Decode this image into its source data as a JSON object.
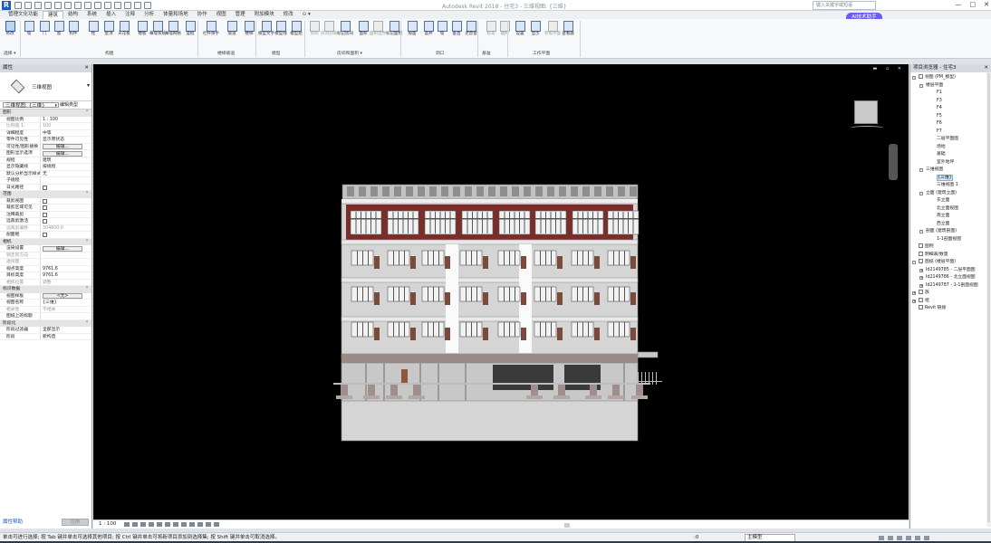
{
  "app": {
    "title": "Autodesk Revit 2018 - 住宅3 - 三维视图: {三维}",
    "search_placeholder": "键入关键字或短语",
    "ai_button": "AI技术助手",
    "window_controls": [
      "—",
      "□",
      "✕"
    ]
  },
  "tabs": [
    "管理文化功能",
    "建筑",
    "结构",
    "系统",
    "插入",
    "注释",
    "分析",
    "体量和场地",
    "协作",
    "视图",
    "管理",
    "附加模块",
    "修改",
    "⊙ ▾"
  ],
  "active_tab": "建筑",
  "ribbon": {
    "buttons": [
      {
        "label": "修改",
        "state": "selected"
      },
      {
        "label": "墙",
        "state": "normal"
      },
      {
        "label": "门",
        "state": "normal"
      },
      {
        "label": "窗",
        "state": "normal"
      },
      {
        "label": "构件",
        "state": "normal"
      },
      {
        "label": "柱",
        "state": "normal"
      },
      {
        "label": "屋顶",
        "state": "normal"
      },
      {
        "label": "天花板",
        "state": "normal"
      },
      {
        "label": "楼板",
        "state": "normal"
      },
      {
        "label": "幕墙系统",
        "state": "normal"
      },
      {
        "label": "幕墙网格",
        "state": "normal"
      },
      {
        "label": "竖梃",
        "state": "normal"
      },
      {
        "label": "栏杆扶手",
        "state": "normal"
      },
      {
        "label": "坡道",
        "state": "normal"
      },
      {
        "label": "楼梯",
        "state": "normal"
      },
      {
        "label": "模型文字",
        "state": "normal"
      },
      {
        "label": "模型线",
        "state": "normal"
      },
      {
        "label": "模型组",
        "state": "normal"
      },
      {
        "label": "房间",
        "state": "gray"
      },
      {
        "label": "房间分隔",
        "state": "gray"
      },
      {
        "label": "标记房间",
        "state": "normal"
      },
      {
        "label": "面积",
        "state": "normal"
      },
      {
        "label": "面积边界",
        "state": "gray"
      },
      {
        "label": "标记面积",
        "state": "normal"
      },
      {
        "label": "按面",
        "state": "normal"
      },
      {
        "label": "竖井",
        "state": "normal"
      },
      {
        "label": "墙",
        "state": "normal"
      },
      {
        "label": "垂直",
        "state": "normal"
      },
      {
        "label": "老虎窗",
        "state": "normal"
      },
      {
        "label": "标高",
        "state": "gray"
      },
      {
        "label": "轴网",
        "state": "gray"
      },
      {
        "label": "设置",
        "state": "normal"
      },
      {
        "label": "显示",
        "state": "normal"
      },
      {
        "label": "参照平面",
        "state": "gray"
      },
      {
        "label": "查看器",
        "state": "normal"
      }
    ],
    "groups": [
      "选择 ▾",
      "构建",
      "楼梯坡道",
      "模型",
      "房间和面积 ▾",
      "洞口",
      "基准",
      "工作平面"
    ]
  },
  "properties": {
    "header": "属性",
    "close": "✕",
    "type_name": "三维视图",
    "view_selector": "三维视图: {三维}",
    "edit_type": "编辑类型",
    "sections": [
      {
        "title": "图形",
        "rows": [
          {
            "k": "视图比例",
            "v": "1 : 100",
            "kind": "input"
          },
          {
            "k": "比例值 1:",
            "v": "100",
            "kind": "dim"
          },
          {
            "k": "详细程度",
            "v": "中等",
            "kind": "text"
          },
          {
            "k": "零件可见性",
            "v": "显示原状态",
            "kind": "text"
          },
          {
            "k": "可见性/图形替换",
            "v": "编辑...",
            "kind": "button"
          },
          {
            "k": "图形显示选项",
            "v": "编辑...",
            "kind": "button"
          },
          {
            "k": "规程",
            "v": "建筑",
            "kind": "text"
          },
          {
            "k": "显示隐藏线",
            "v": "按规程",
            "kind": "text"
          },
          {
            "k": "默认分析显示样式",
            "v": "无",
            "kind": "text"
          },
          {
            "k": "子规程",
            "v": "",
            "kind": "text"
          },
          {
            "k": "日光路径",
            "v": "",
            "kind": "check"
          }
        ]
      },
      {
        "title": "范围",
        "rows": [
          {
            "k": "裁剪视图",
            "v": "",
            "kind": "check"
          },
          {
            "k": "裁剪区域可见",
            "v": "",
            "kind": "check"
          },
          {
            "k": "注释裁剪",
            "v": "",
            "kind": "check"
          },
          {
            "k": "远裁剪激活",
            "v": "",
            "kind": "check"
          },
          {
            "k": "远裁剪偏移",
            "v": "304800.0",
            "kind": "dim"
          },
          {
            "k": "剖面框",
            "v": "",
            "kind": "check"
          }
        ]
      },
      {
        "title": "相机",
        "rows": [
          {
            "k": "渲染设置",
            "v": "编辑...",
            "kind": "button"
          },
          {
            "k": "锁定的方向",
            "v": "",
            "kind": "dim"
          },
          {
            "k": "透视图",
            "v": "",
            "kind": "dim"
          },
          {
            "k": "视点高度",
            "v": "9761.6",
            "kind": "text"
          },
          {
            "k": "目标高度",
            "v": "9761.6",
            "kind": "text"
          },
          {
            "k": "相机位置",
            "v": "调整",
            "kind": "dim"
          }
        ]
      },
      {
        "title": "标识数据",
        "rows": [
          {
            "k": "视图样板",
            "v": "<无>",
            "kind": "button"
          },
          {
            "k": "视图名称",
            "v": "{三维}",
            "kind": "text"
          },
          {
            "k": "相关性",
            "v": "不相关",
            "kind": "dim"
          },
          {
            "k": "图纸上的标题",
            "v": "",
            "kind": "text"
          }
        ]
      },
      {
        "title": "阶段化",
        "rows": [
          {
            "k": "阶段过滤器",
            "v": "全部显示",
            "kind": "text"
          },
          {
            "k": "阶段",
            "v": "新构造",
            "kind": "text"
          }
        ]
      }
    ],
    "help_link": "属性帮助",
    "apply": "应用"
  },
  "browser": {
    "header": "项目浏览器 - 住宅3",
    "close": "✕",
    "items": [
      {
        "label": "视图 (PM_模型)",
        "level": 0,
        "exp": "-",
        "icon": true
      },
      {
        "label": "楼层平面",
        "level": 1,
        "exp": "-"
      },
      {
        "label": "F1",
        "level": 2
      },
      {
        "label": "F3",
        "level": 2
      },
      {
        "label": "F4",
        "level": 2
      },
      {
        "label": "F5",
        "level": 2
      },
      {
        "label": "F6",
        "level": 2
      },
      {
        "label": "F7",
        "level": 2
      },
      {
        "label": "二层平面图",
        "level": 2
      },
      {
        "label": "场地",
        "level": 2
      },
      {
        "label": "基础",
        "level": 2
      },
      {
        "label": "室外地坪",
        "level": 2
      },
      {
        "label": "三维视图",
        "level": 1,
        "exp": "-"
      },
      {
        "label": "{三维}",
        "level": 2,
        "highlight": true
      },
      {
        "label": "三维视图 1",
        "level": 2
      },
      {
        "label": "立面 (建筑立面)",
        "level": 1,
        "exp": "-"
      },
      {
        "label": "东立面",
        "level": 2
      },
      {
        "label": "北立面视图",
        "level": 2
      },
      {
        "label": "南立面",
        "level": 2
      },
      {
        "label": "西立面",
        "level": 2
      },
      {
        "label": "剖面 (建筑剖面)",
        "level": 1,
        "exp": "-"
      },
      {
        "label": "1-1剖面视图",
        "level": 2
      },
      {
        "label": "图例",
        "level": 0,
        "icon": true
      },
      {
        "label": "明细表/数量",
        "level": 0,
        "icon": true
      },
      {
        "label": "图纸 (楼层平面)",
        "level": 0,
        "exp": "-",
        "icon": true
      },
      {
        "label": "Id2149785 - 二层平面图",
        "level": 1,
        "exp": "+"
      },
      {
        "label": "Id2149786 - 北立面视图",
        "level": 1,
        "exp": "+"
      },
      {
        "label": "Id2149787 - 1-1剖面视图",
        "level": 1,
        "exp": "+"
      },
      {
        "label": "族",
        "level": 0,
        "exp": "+",
        "icon": true
      },
      {
        "label": "组",
        "level": 0,
        "exp": "+",
        "icon": true
      },
      {
        "label": "Revit 链接",
        "level": 0,
        "icon": true
      }
    ]
  },
  "view_bar": {
    "scale": "1 : 100"
  },
  "status": {
    "message": "单击可进行选择; 按 Tab 键并单击可选择其他项目; 按 Ctrl 键并单击可将新项目添加到选择集; 按 Shift 键并单击可取消选择。",
    "zero": ":0",
    "model": "主模型"
  },
  "colors": {
    "viewport_bg": "#000000",
    "facade": "#d5d5d5",
    "band": "#7a2e2a",
    "accent": "#1e5bb8"
  }
}
